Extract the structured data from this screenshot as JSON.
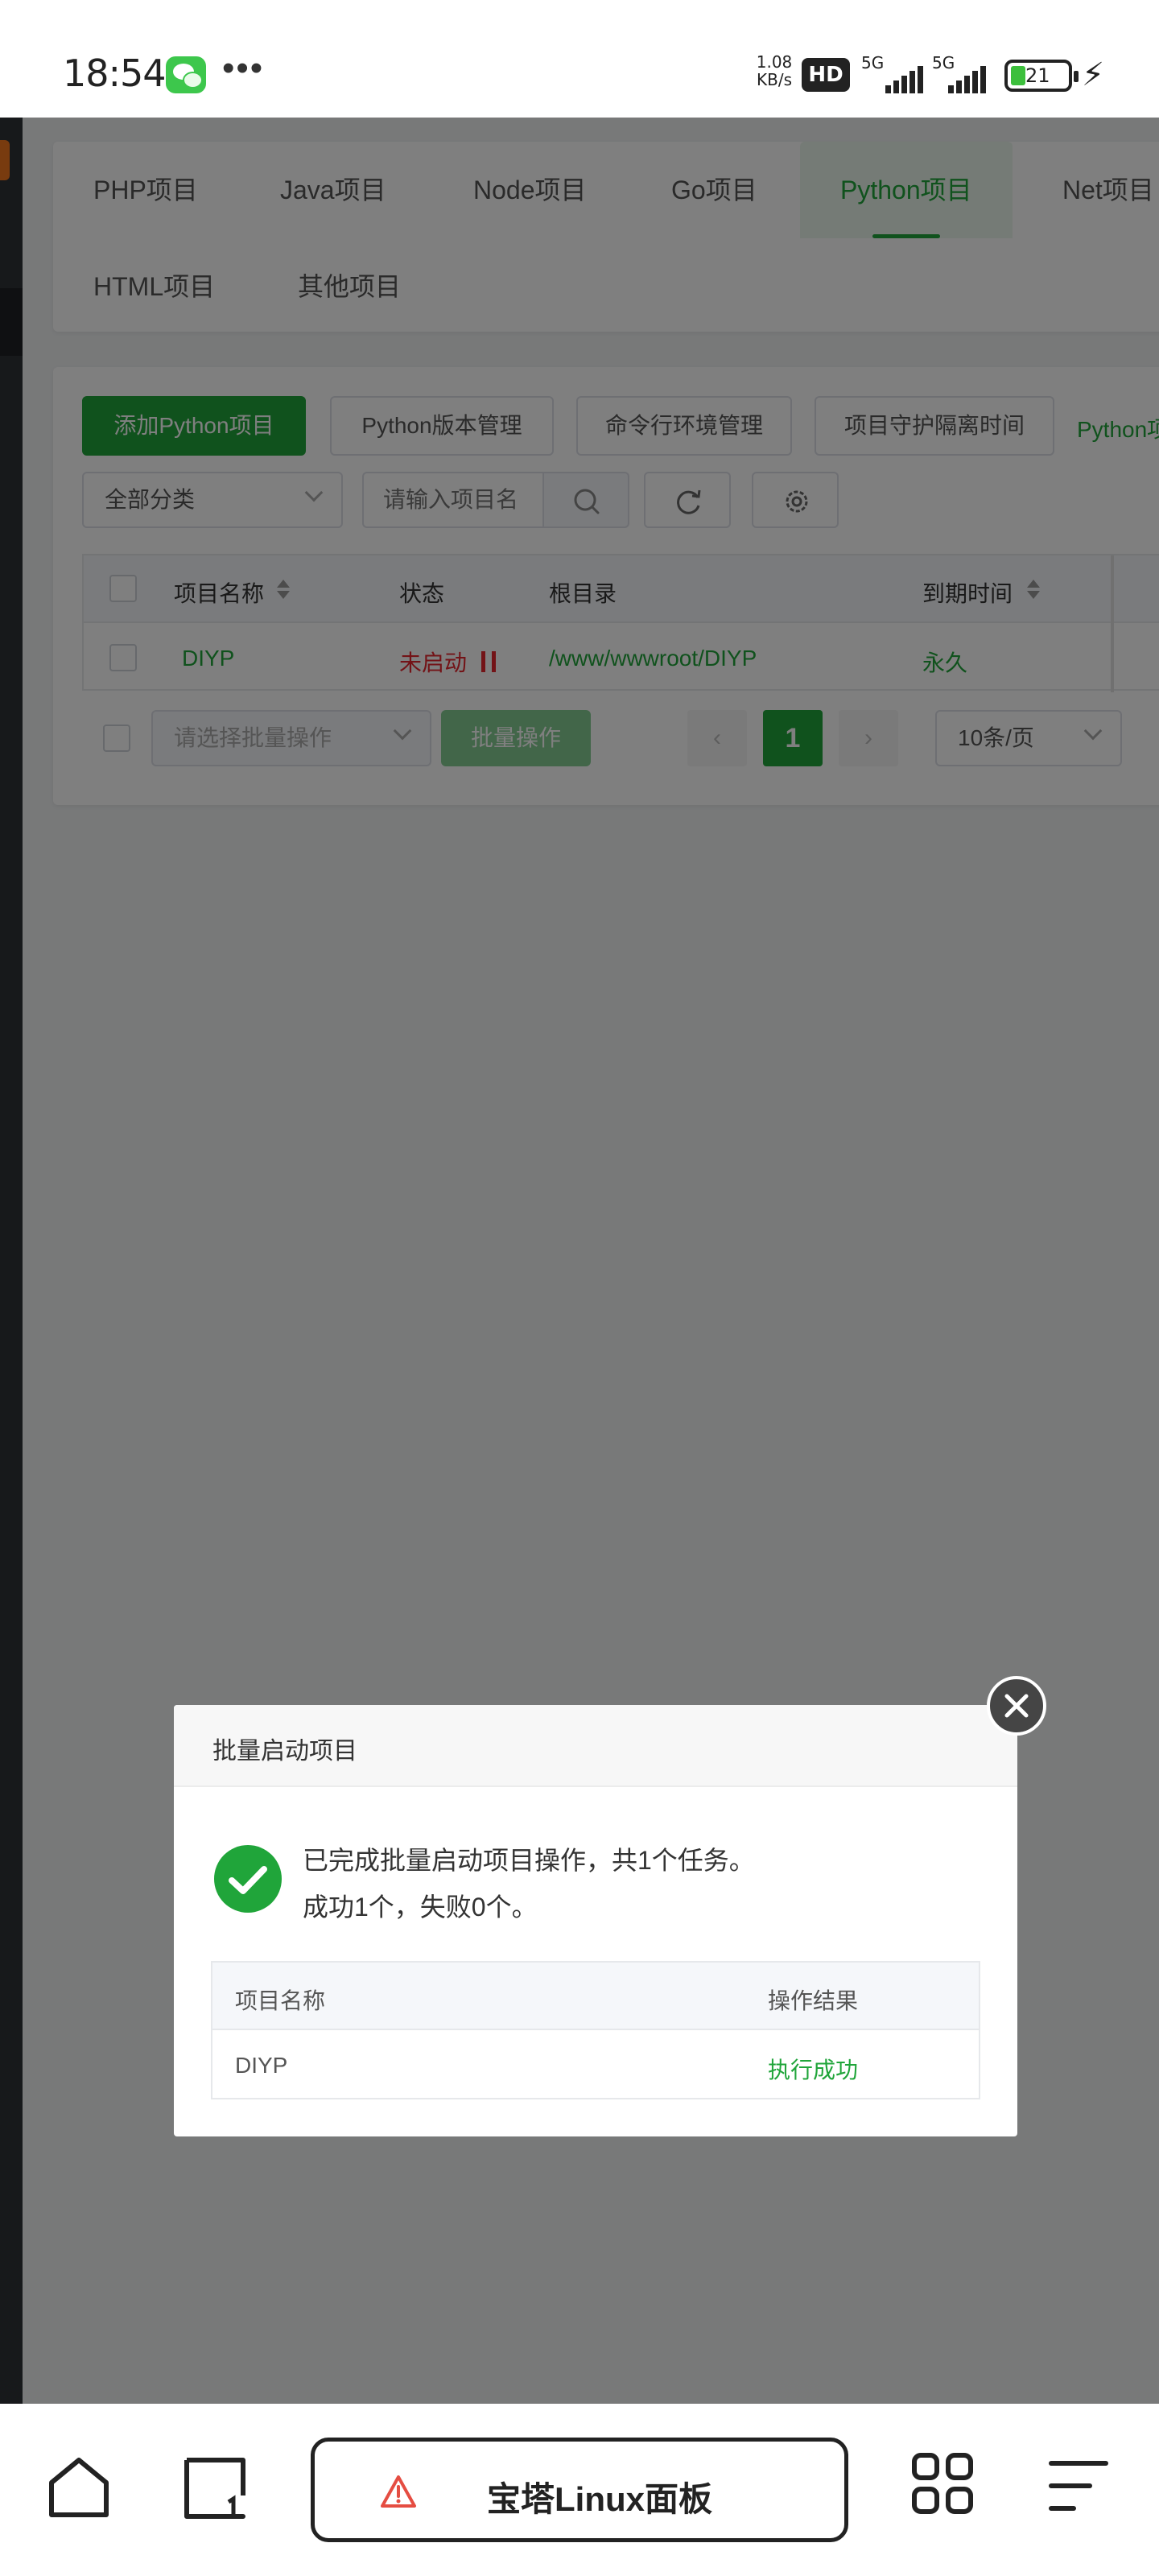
{
  "status_bar": {
    "time": "18:54",
    "more": "•••",
    "speed_value": "1.08",
    "speed_unit": "KB/s",
    "hd_badge": "HD",
    "signal1_label": "5G",
    "signal2_label": "5G",
    "battery_level": "21"
  },
  "tabs": [
    {
      "label": "PHP项目"
    },
    {
      "label": "Java项目"
    },
    {
      "label": "Node项目"
    },
    {
      "label": "Go项目"
    },
    {
      "label": "Python项目",
      "active": true
    },
    {
      "label": "Net项目"
    },
    {
      "label": "HTML项目"
    },
    {
      "label": "其他项目"
    }
  ],
  "toolbar": {
    "add_button": "添加Python项目",
    "version_button": "Python版本管理",
    "cli_button": "命令行环境管理",
    "guard_button": "项目守护隔离时间",
    "extra_link": "Python项"
  },
  "filter": {
    "category": "全部分类",
    "search_placeholder": "请输入项目名"
  },
  "table": {
    "headers": [
      "项目名称",
      "状态",
      "根目录",
      "到期时间"
    ],
    "rows": [
      {
        "name": "DIYP",
        "status": "未启动",
        "root": "/www/wwwroot/DIYP",
        "expire": "永久"
      }
    ]
  },
  "batch": {
    "select_placeholder": "请选择批量操作",
    "button": "批量操作",
    "current_page": "1",
    "page_size": "10条/页"
  },
  "modal": {
    "title": "批量启动项目",
    "message_line1": "已完成批量启动项目操作，共1个任务。",
    "message_line2": "成功1个，失败0个。",
    "headers": [
      "项目名称",
      "操作结果"
    ],
    "rows": [
      {
        "name": "DIYP",
        "result": "执行成功"
      }
    ]
  },
  "bottom_nav": {
    "address": "宝塔Linux面板"
  },
  "colors": {
    "accent": "#20a53a",
    "danger": "#e6262e",
    "sidebar": "#2f3237"
  }
}
